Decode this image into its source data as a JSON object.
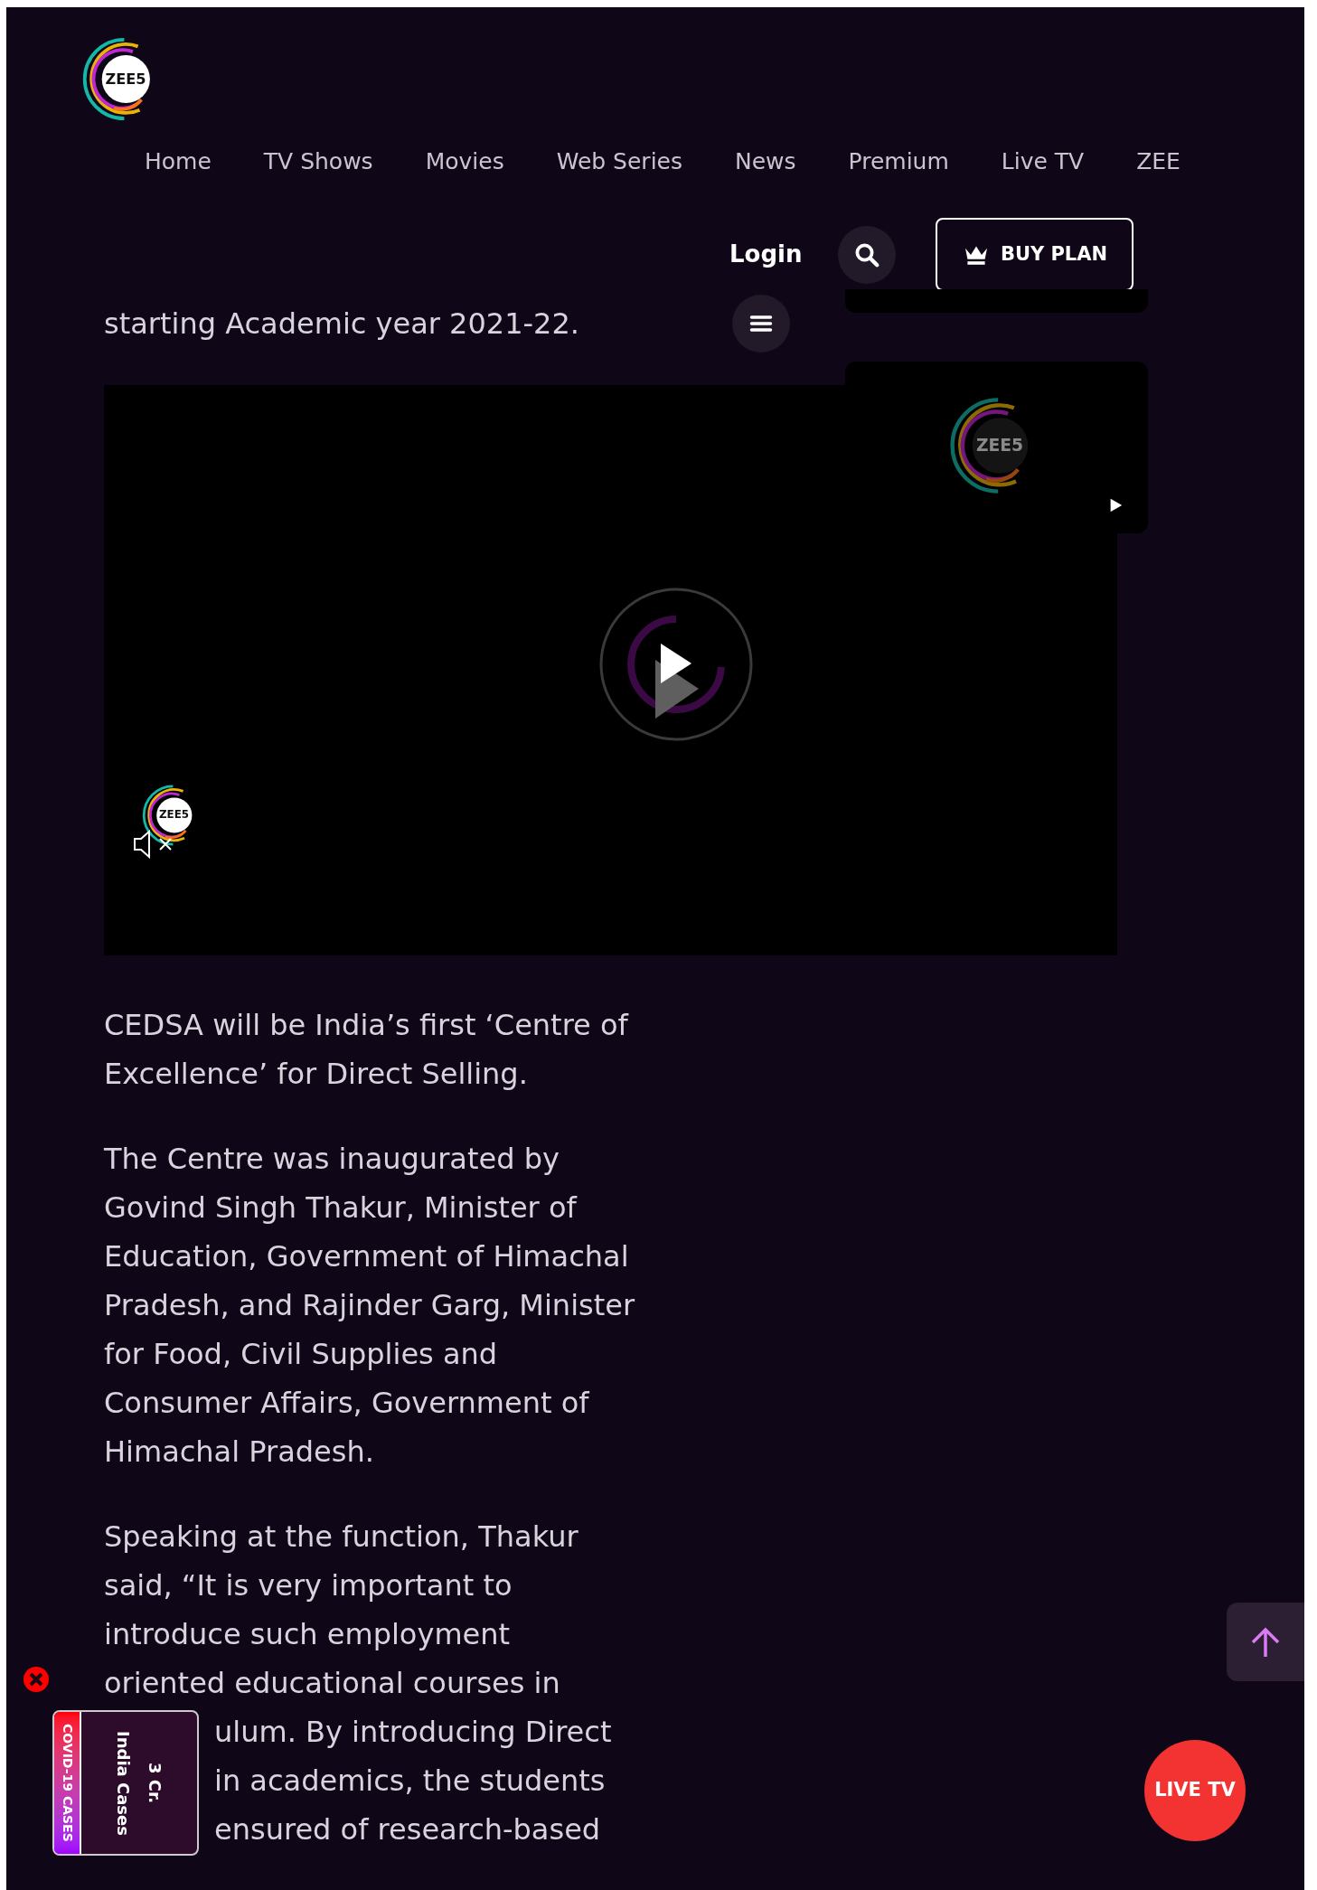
{
  "header": {
    "logo_text": "ZEE5",
    "nav": [
      {
        "label": "Home"
      },
      {
        "label": "TV Shows"
      },
      {
        "label": "Movies"
      },
      {
        "label": "Web Series"
      },
      {
        "label": "News"
      },
      {
        "label": "Premium"
      },
      {
        "label": "Live TV"
      },
      {
        "label": "ZEE"
      }
    ],
    "login": "Login",
    "buy_plan": "BUY PLAN"
  },
  "article": {
    "lead_fragment": "starting Academic year 2021-22.",
    "video": {
      "logo_text": "ZEE5",
      "muted": true
    },
    "paragraphs": [
      "CEDSA will be India’s first ‘Centre of Excellence’ for Direct Selling.",
      "The Centre was inaugurated by Govind Singh Thakur, Minister of Education, Government of Himachal Pradesh, and Rajinder Garg, Minister for Food, Civil Supplies and Consumer Affairs, Government of Himachal Pradesh."
    ],
    "last_paragraph_lines": [
      "Speaking at the function, Thakur",
      "said, “It is very important to",
      "introduce such employment",
      "oriented educational courses in"
    ],
    "lines_beside_widget": [
      "ulum. By introducing Direct",
      "in academics, the students",
      "ensured of research-based"
    ]
  },
  "side_card": {
    "logo_text": "ZEE5"
  },
  "covid_widget": {
    "title": "COVID-19 CASES",
    "label": "India Cases",
    "count": "3 Cr."
  },
  "live_tv": "LIVE TV"
}
